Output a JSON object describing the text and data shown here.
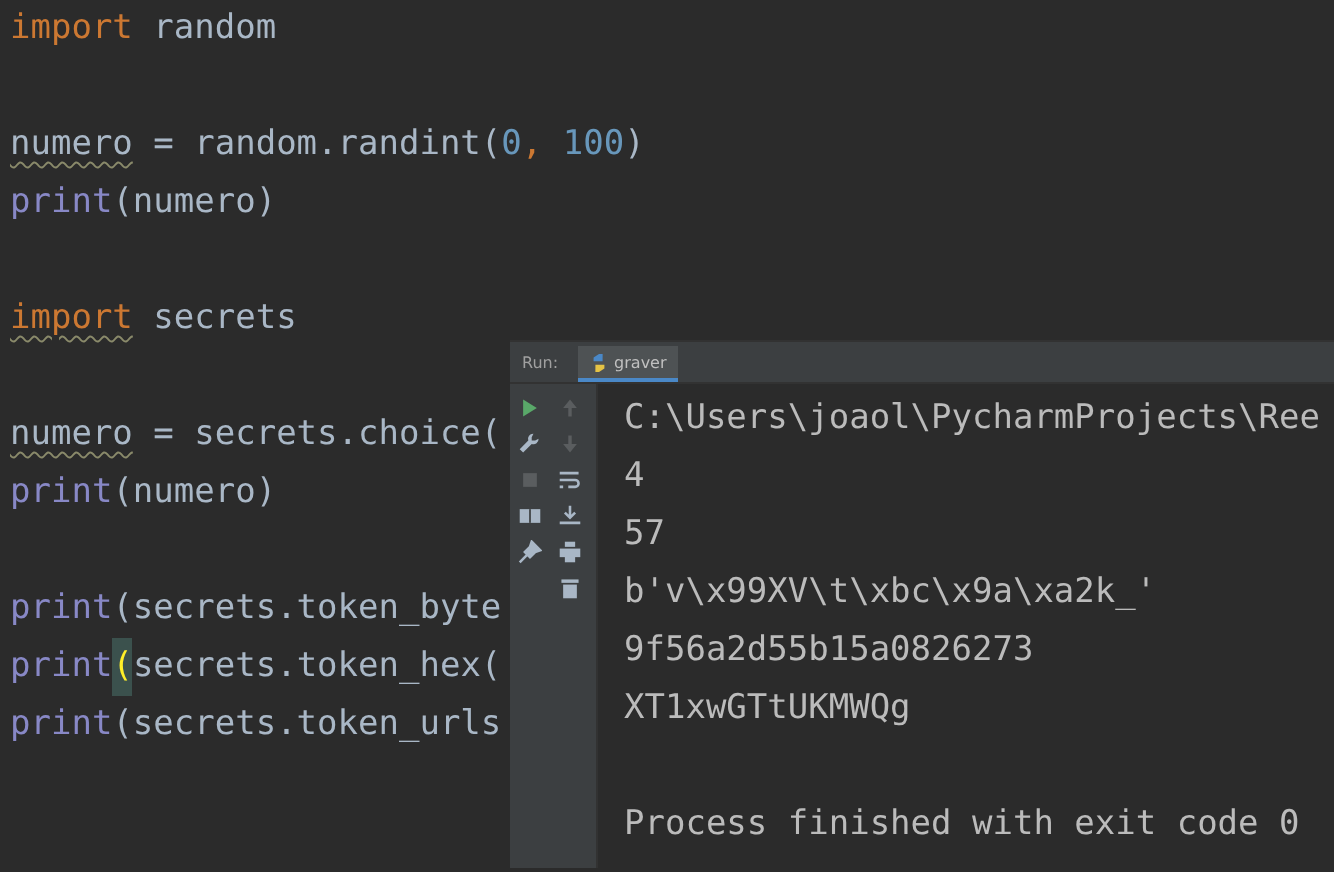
{
  "editor": {
    "blocks": [
      [
        [
          {
            "text": "import",
            "kind": "keyword",
            "squiggle": false
          },
          {
            "text": " random",
            "kind": "text",
            "squiggle": false
          }
        ]
      ],
      [
        [
          {
            "text": "numero",
            "kind": "text",
            "squiggle": true
          },
          {
            "text": " = random.randint(",
            "kind": "text",
            "squiggle": false
          },
          {
            "text": "0",
            "kind": "number",
            "squiggle": false
          },
          {
            "text": ", ",
            "kind": "keyword",
            "squiggle": false
          },
          {
            "text": "100",
            "kind": "number",
            "squiggle": false
          },
          {
            "text": ")",
            "kind": "text",
            "squiggle": false
          }
        ],
        [
          {
            "text": "print",
            "kind": "builtin",
            "squiggle": false
          },
          {
            "text": "(numero)",
            "kind": "text",
            "squiggle": false
          }
        ]
      ],
      [
        [
          {
            "text": "import",
            "kind": "keyword",
            "squiggle": true
          },
          {
            "text": " secrets",
            "kind": "text",
            "squiggle": false
          }
        ]
      ],
      [
        [
          {
            "text": "numero",
            "kind": "text",
            "squiggle": true
          },
          {
            "text": " = secrets.choice(",
            "kind": "text",
            "squiggle": false
          }
        ],
        [
          {
            "text": "print",
            "kind": "builtin",
            "squiggle": false
          },
          {
            "text": "(numero)",
            "kind": "text",
            "squiggle": false
          }
        ]
      ],
      [
        [
          {
            "text": "print",
            "kind": "builtin",
            "squiggle": false
          },
          {
            "text": "(secrets.token_byte",
            "kind": "text",
            "squiggle": false
          }
        ],
        [
          {
            "text": "print",
            "kind": "builtin",
            "squiggle": false
          },
          {
            "text": "(",
            "kind": "bracket-match",
            "squiggle": false
          },
          {
            "text": "secrets.token_hex(",
            "kind": "text",
            "squiggle": false
          }
        ],
        [
          {
            "text": "print",
            "kind": "builtin",
            "squiggle": false
          },
          {
            "text": "(secrets.token_urls",
            "kind": "text",
            "squiggle": false
          }
        ]
      ]
    ]
  },
  "run_panel": {
    "label": "Run:",
    "tabs": [
      {
        "label": "graver",
        "selected": true
      }
    ],
    "toolbar": [
      [
        {
          "kind": "run",
          "disabled": false
        },
        {
          "kind": "wrench",
          "disabled": false
        },
        {
          "kind": "stop",
          "disabled": true
        },
        {
          "kind": "layout",
          "disabled": false
        },
        {
          "kind": "pin",
          "disabled": false
        }
      ],
      [
        {
          "kind": "up",
          "disabled": true
        },
        {
          "kind": "down",
          "disabled": true
        },
        {
          "kind": "wrap",
          "disabled": false
        },
        {
          "kind": "scroll-end",
          "disabled": false
        },
        {
          "kind": "print",
          "disabled": false
        },
        {
          "kind": "trash",
          "disabled": false
        }
      ]
    ],
    "output_blocks": [
      [
        "C:\\Users\\joaol\\PycharmProjects\\Ree",
        "4",
        "57",
        "b'v\\x99XV\\t\\xbc\\x9a\\xa2k_'",
        "9f56a2d55b15a0826273",
        "XT1xwGTtUKMWQg"
      ],
      [
        "Process finished with exit code 0"
      ]
    ]
  }
}
